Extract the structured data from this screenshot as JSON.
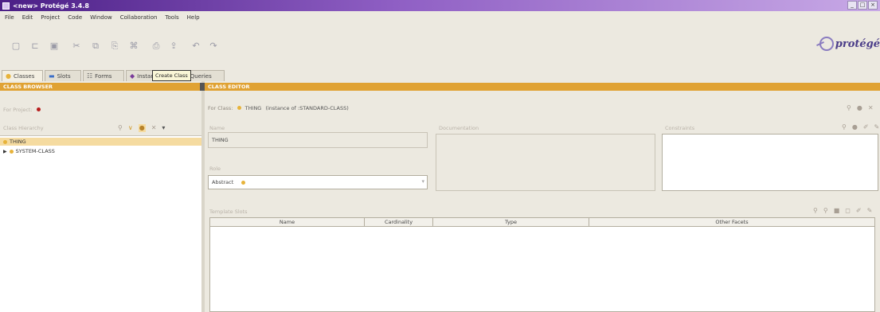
{
  "window": {
    "title": "<new> Protégé 3.4.8",
    "controls": [
      "_",
      "□",
      "×"
    ]
  },
  "menu": [
    "File",
    "Edit",
    "Project",
    "Code",
    "Window",
    "Collaboration",
    "Tools",
    "Help"
  ],
  "toolbar": {
    "icons": [
      "new-file-icon",
      "open-folder-icon",
      "save-icon",
      "cut-icon",
      "copy-icon",
      "paste-icon",
      "find-icon",
      "print-icon",
      "export-icon",
      "undo-icon",
      "redo-icon"
    ],
    "logo_text": "protégé"
  },
  "tabs": [
    {
      "label": "Classes",
      "icon": "class-dot-icon",
      "color": "#e7b33a"
    },
    {
      "label": "Slots",
      "icon": "slot-bar-icon",
      "color": "#3b6fc8"
    },
    {
      "label": "Forms",
      "icon": "form-grid-icon",
      "color": "#666666"
    },
    {
      "label": "Instances",
      "icon": "instance-diamond-icon",
      "color": "#7a3b9a"
    },
    {
      "label": "Queries",
      "icon": "query-icon",
      "color": "#d24030"
    }
  ],
  "class_browser": {
    "header": "CLASS BROWSER",
    "for_project_label": "For Project:",
    "hierarchy_label": "Class Hierarchy",
    "tooltip": "Create Class",
    "tree": [
      {
        "label": "THING",
        "selected": true
      },
      {
        "label": "SYSTEM-CLASS",
        "selected": false
      }
    ]
  },
  "class_editor": {
    "header": "CLASS EDITOR",
    "for_class_label": "For Class:",
    "class_name": "THING",
    "instance_of": "(instance of :STANDARD-CLASS)",
    "name_label": "Name",
    "name_value": "THING",
    "role_label": "Role",
    "role_value": "Abstract",
    "documentation_label": "Documentation",
    "constraints_label": "Constraints",
    "template_slots_label": "Template Slots",
    "columns": [
      "Name",
      "Cardinality",
      "Type",
      "Other Facets"
    ]
  },
  "colors": {
    "accent_orange": "#e0a233",
    "title_purple": "#4b1f86"
  }
}
